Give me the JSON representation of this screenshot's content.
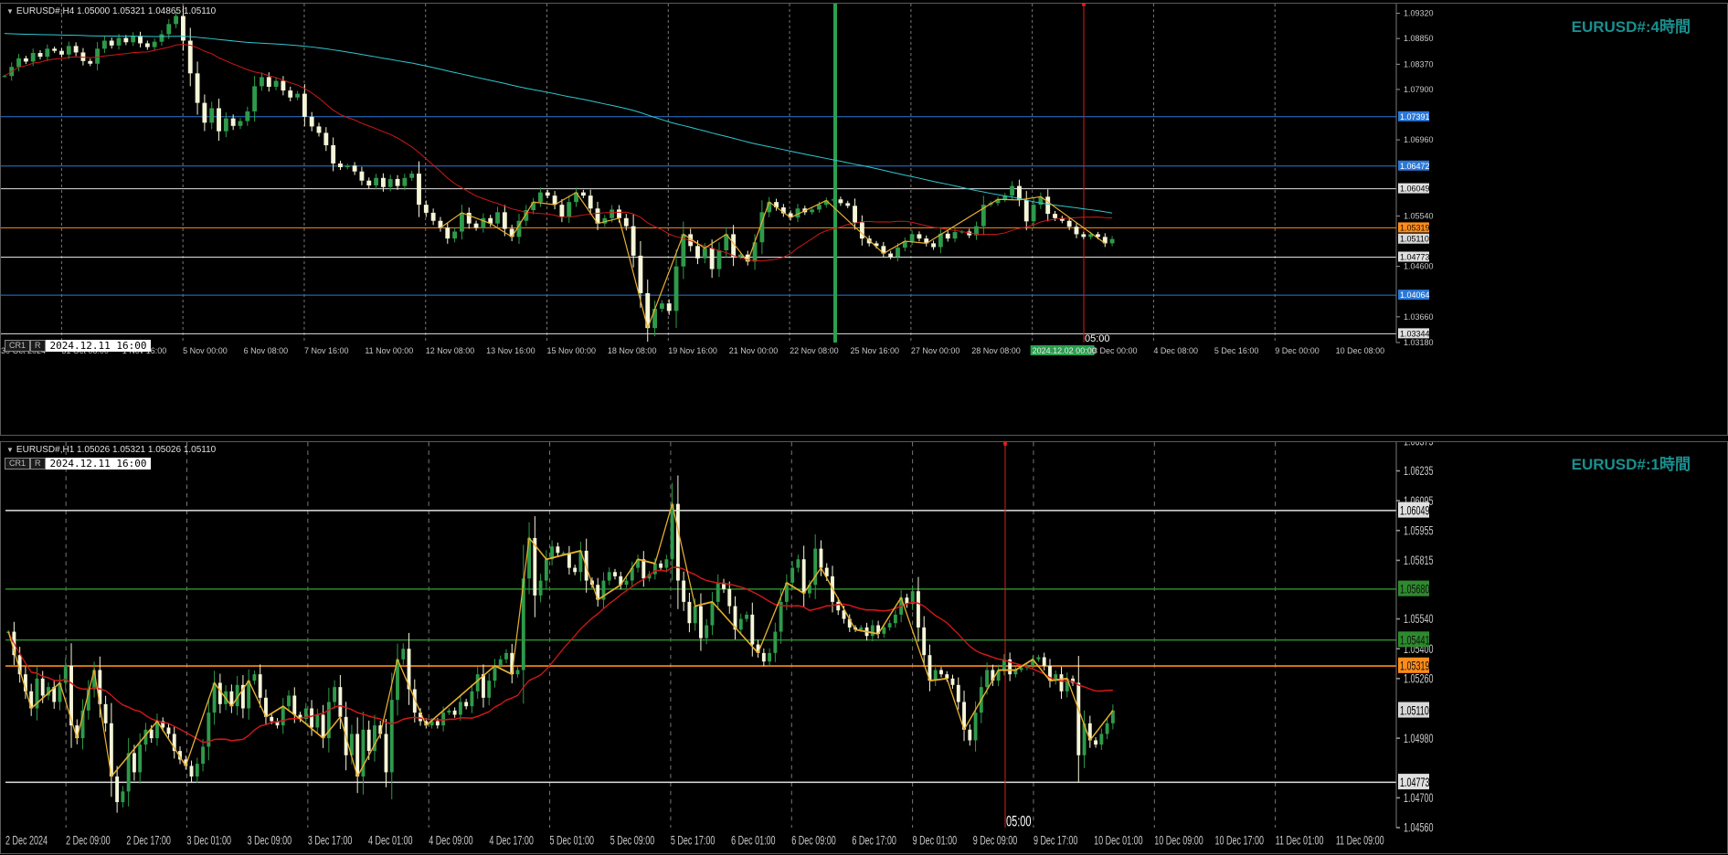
{
  "colors": {
    "background": "#000000",
    "grid": "#777777",
    "up_body": "#2e9a4a",
    "down_body": "#f5f5d8",
    "ma_red": "#d01818",
    "ma_cyan": "#30c8d0",
    "zigzag": "#e8b030",
    "white_level": "#e0e0e0",
    "blue_level": "#2a78d8",
    "orange_level": "#ff8c1a",
    "green_level": "#2d8a2d",
    "vline_green": "#2aa050",
    "vline_red": "#e01c1c",
    "title": "#1a8f8f"
  },
  "chart_data": [
    {
      "type": "candlestick",
      "header": "EURUSD#,H4  1.05000 1.05321 1.04865 1.05110",
      "title": "EURUSD#:4時間",
      "toolbar": {
        "cr": "CR1",
        "r": "R",
        "datetime": "2024.12.11 16:00"
      },
      "ylim": [
        1.0318,
        1.095
      ],
      "yticks": [
        "1.09320",
        "1.08850",
        "1.08370",
        "1.07900",
        "1.06960",
        "1.05540",
        "1.04600",
        "1.03660",
        "1.03180"
      ],
      "xticks": [
        "30 Oct 2024",
        "31 Oct 08:00",
        "1 Nov 16:00",
        "5 Nov 00:00",
        "6 Nov 08:00",
        "7 Nov 16:00",
        "11 Nov 00:00",
        "12 Nov 08:00",
        "13 Nov 16:00",
        "15 Nov 00:00",
        "18 Nov 08:00",
        "19 Nov 16:00",
        "21 Nov 00:00",
        "22 Nov 08:00",
        "25 Nov 16:00",
        "27 Nov 00:00",
        "28 Nov 08:00",
        "2024.12.02 00:00",
        "3 Dec 00:00",
        "4 Dec 08:00",
        "5 Dec 16:00",
        "9 Dec 00:00",
        "10 Dec 08:00"
      ],
      "highlighted_xtick": "2024.12.02 00:00",
      "levels": [
        {
          "value": 1.07391,
          "label": "1.07391",
          "kind": "blue"
        },
        {
          "value": 1.06472,
          "label": "1.06472",
          "kind": "blue"
        },
        {
          "value": 1.06049,
          "label": "1.06049",
          "kind": "white"
        },
        {
          "value": 1.05319,
          "label": "1.05319",
          "kind": "orange"
        },
        {
          "value": 1.04773,
          "label": "1.04773",
          "kind": "white"
        },
        {
          "value": 1.04064,
          "label": "1.04064",
          "kind": "blue"
        },
        {
          "value": 1.03344,
          "label": "1.03344",
          "kind": "white"
        }
      ],
      "current_price": "1.05110",
      "vline_label": "05:00",
      "close_series": [
        1.0815,
        1.0832,
        1.0848,
        1.0842,
        1.0858,
        1.0851,
        1.0866,
        1.0862,
        1.0855,
        1.0871,
        1.0859,
        1.0843,
        1.0838,
        1.0866,
        1.0881,
        1.0872,
        1.0886,
        1.0878,
        1.089,
        1.0876,
        1.0869,
        1.0879,
        1.0893,
        1.0912,
        1.0927,
        1.0881,
        1.082,
        1.0765,
        1.0728,
        1.0755,
        1.0712,
        1.0736,
        1.0722,
        1.0731,
        1.0749,
        1.0796,
        1.0813,
        1.0795,
        1.0806,
        1.0788,
        1.0775,
        1.0782,
        1.0739,
        1.0721,
        1.0709,
        1.0686,
        1.0652,
        1.0645,
        1.0648,
        1.0637,
        1.062,
        1.0611,
        1.0625,
        1.0608,
        1.0623,
        1.061,
        1.0625,
        1.0633,
        1.0575,
        1.056,
        1.0545,
        1.0532,
        1.0512,
        1.0525,
        1.056,
        1.054,
        1.0532,
        1.055,
        1.054,
        1.0561,
        1.053,
        1.0515,
        1.0545,
        1.0565,
        1.058,
        1.0598,
        1.0592,
        1.0575,
        1.0553,
        1.058,
        1.0598,
        1.0592,
        1.0568,
        1.054,
        1.055,
        1.0566,
        1.055,
        1.0535,
        1.048,
        1.041,
        1.0345,
        1.0381,
        1.0391,
        1.0377,
        1.046,
        1.052,
        1.0498,
        1.0475,
        1.0494,
        1.0455,
        1.049,
        1.052,
        1.0478,
        1.0482,
        1.0469,
        1.0505,
        1.0561,
        1.058,
        1.057,
        1.0559,
        1.0551,
        1.0568,
        1.0561,
        1.0566,
        1.0575,
        1.0583,
        1.0585,
        1.0578,
        1.0573,
        1.0542,
        1.0512,
        1.0503,
        1.0498,
        1.0484,
        1.0478,
        1.0495,
        1.0507,
        1.052,
        1.0512,
        1.0503,
        1.0496,
        1.0521,
        1.0512,
        1.0524,
        1.0525,
        1.0518,
        1.0535,
        1.0575,
        1.0578,
        1.0585,
        1.0592,
        1.061,
        1.0584,
        1.0544,
        1.0575,
        1.059,
        1.0558,
        1.055,
        1.0545,
        1.0534,
        1.052,
        1.0515,
        1.052,
        1.0515,
        1.0503,
        1.0511
      ]
    },
    {
      "type": "candlestick",
      "header": "EURUSD#,H1  1.05026 1.05321 1.05026 1.05110",
      "title": "EURUSD#:1時間",
      "toolbar": {
        "cr": "CR1",
        "r": "R",
        "datetime": "2024.12.11 16:00"
      },
      "ylim": [
        1.0456,
        1.0637
      ],
      "yticks": [
        "1.06375",
        "1.06235",
        "1.06095",
        "1.05955",
        "1.05815",
        "1.05540",
        "1.05400",
        "1.05260",
        "1.04980",
        "1.04700",
        "1.04560"
      ],
      "xticks": [
        "2 Dec 2024",
        "2 Dec 09:00",
        "2 Dec 17:00",
        "3 Dec 01:00",
        "3 Dec 09:00",
        "3 Dec 17:00",
        "4 Dec 01:00",
        "4 Dec 09:00",
        "4 Dec 17:00",
        "5 Dec 01:00",
        "5 Dec 09:00",
        "5 Dec 17:00",
        "6 Dec 01:00",
        "6 Dec 09:00",
        "6 Dec 17:00",
        "9 Dec 01:00",
        "9 Dec 09:00",
        "9 Dec 17:00",
        "10 Dec 01:00",
        "10 Dec 09:00",
        "10 Dec 17:00",
        "11 Dec 01:00",
        "11 Dec 09:00"
      ],
      "levels": [
        {
          "value": 1.06049,
          "label": "1.06049",
          "kind": "white"
        },
        {
          "value": 1.0568,
          "label": "1.05680",
          "kind": "green"
        },
        {
          "value": 1.05441,
          "label": "1.05441",
          "kind": "green"
        },
        {
          "value": 1.05319,
          "label": "1.05319",
          "kind": "orange"
        },
        {
          "value": 1.04773,
          "label": "1.04773",
          "kind": "white"
        }
      ],
      "current_price": "1.05110",
      "vline_label": "05:00",
      "close_series": [
        1.0548,
        1.0537,
        1.0528,
        1.052,
        1.0512,
        1.0526,
        1.0518,
        1.0522,
        1.0515,
        1.0524,
        1.0532,
        1.0504,
        1.0498,
        1.0511,
        1.0521,
        1.053,
        1.0514,
        1.0505,
        1.048,
        1.0468,
        1.0473,
        1.0491,
        1.0482,
        1.0495,
        1.0502,
        1.0498,
        1.0506,
        1.0503,
        1.05,
        1.0492,
        1.0488,
        1.0485,
        1.048,
        1.0486,
        1.0494,
        1.051,
        1.0524,
        1.0514,
        1.052,
        1.0513,
        1.0523,
        1.0512,
        1.0525,
        1.0528,
        1.0517,
        1.0508,
        1.0506,
        1.0504,
        1.0513,
        1.0518,
        1.0509,
        1.0507,
        1.0512,
        1.0503,
        1.0509,
        1.0498,
        1.0515,
        1.0522,
        1.0508,
        1.049,
        1.05,
        1.048,
        1.0502,
        1.0492,
        1.0504,
        1.05,
        1.0482,
        1.0516,
        1.0535,
        1.054,
        1.0521,
        1.051,
        1.0506,
        1.0504,
        1.0506,
        1.0504,
        1.051,
        1.0511,
        1.0509,
        1.0515,
        1.0513,
        1.052,
        1.0528,
        1.0517,
        1.0525,
        1.0532,
        1.0535,
        1.0538,
        1.0528,
        1.053,
        1.0573,
        1.0592,
        1.0565,
        1.0572,
        1.0582,
        1.0588,
        1.0585,
        1.0585,
        1.0578,
        1.0576,
        1.0586,
        1.0572,
        1.057,
        1.0563,
        1.0572,
        1.0576,
        1.0574,
        1.057,
        1.0572,
        1.0578,
        1.0582,
        1.0573,
        1.0575,
        1.058,
        1.0578,
        1.0582,
        1.0608,
        1.0572,
        1.0562,
        1.0552,
        1.056,
        1.0545,
        1.0551,
        1.0562,
        1.0571,
        1.0568,
        1.056,
        1.0549,
        1.0554,
        1.0556,
        1.0542,
        1.0538,
        1.0534,
        1.0538,
        1.0548,
        1.0562,
        1.0571,
        1.0578,
        1.0582,
        1.0566,
        1.057,
        1.0587,
        1.0578,
        1.0574,
        1.0562,
        1.0558,
        1.0554,
        1.055,
        1.0549,
        1.055,
        1.0546,
        1.0551,
        1.0547,
        1.055,
        1.0552,
        1.0556,
        1.0564,
        1.0561,
        1.0567,
        1.055,
        1.0537,
        1.0525,
        1.053,
        1.0528,
        1.0526,
        1.0523,
        1.0515,
        1.0502,
        1.0497,
        1.051,
        1.0522,
        1.053,
        1.0525,
        1.053,
        1.0535,
        1.0528,
        1.053,
        1.0531,
        1.0532,
        1.0535,
        1.0536,
        1.0532,
        1.0525,
        1.0528,
        1.052,
        1.0526,
        1.0524,
        1.049,
        1.0505,
        1.0497,
        1.0495,
        1.05,
        1.0505,
        1.0511
      ]
    }
  ]
}
